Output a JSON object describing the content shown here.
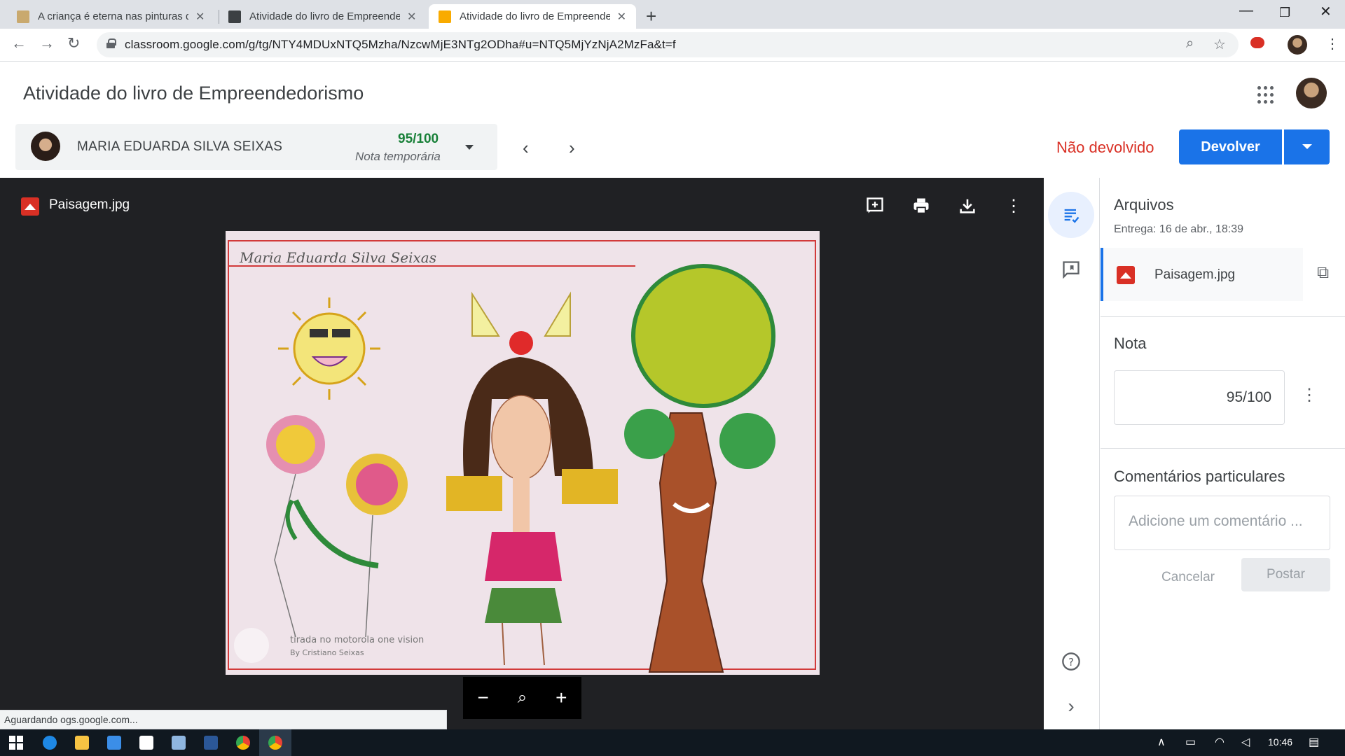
{
  "browser": {
    "tabs": [
      {
        "label": "A criança é eterna nas pinturas de",
        "active": false
      },
      {
        "label": "Atividade do livro de Empreende",
        "active": false
      },
      {
        "label": "Atividade do livro de Empreende",
        "active": true
      }
    ],
    "new_tab_label": "+",
    "url": "classroom.google.com/g/tg/NTY4MDUxNTQ5Mzha/NzcwMjE3NTg2ODha#u=NTQ5MjYzNjA2MzFa&t=f",
    "status_text": "Aguardando ogs.google.com..."
  },
  "header": {
    "title": "Atividade do livro de Empreendedorismo"
  },
  "student": {
    "name": "MARIA EDUARDA SILVA SEIXAS",
    "grade": "95/100",
    "grade_note": "Nota temporária",
    "status": "Não devolvido",
    "return_button": "Devolver"
  },
  "viewer": {
    "filename": "Paisagem.jpg",
    "image_caption_line1": "tirada no motorola one vision",
    "image_caption_line2": "By Cristiano Seixas",
    "image_name_written": "Maria Eduarda Silva Seixas"
  },
  "panel": {
    "files_heading": "Arquivos",
    "delivery": "Entrega: 16 de abr., 18:39",
    "attachment_name": "Paisagem.jpg",
    "grade_heading": "Nota",
    "grade_value": "95/100",
    "comments_heading": "Comentários particulares",
    "comment_placeholder": "Adicione um comentário ...",
    "cancel_label": "Cancelar",
    "post_label": "Postar"
  },
  "taskbar": {
    "clock": "10:46"
  },
  "colors": {
    "accent": "#1a73e8",
    "grade_green": "#188038",
    "status_red": "#d93025",
    "viewer_bg": "#202124"
  },
  "icons": [
    "back-icon",
    "forward-icon",
    "reload-icon",
    "lock-icon",
    "zoom-icon",
    "star-icon",
    "menu-icon",
    "apps-icon",
    "add-comment-icon",
    "print-icon",
    "download-icon",
    "more-icon",
    "zoom-out-icon",
    "zoom-search-icon",
    "zoom-in-icon",
    "instructions-icon",
    "comments-icon",
    "help-icon",
    "expand-icon",
    "open-in-new-icon"
  ]
}
